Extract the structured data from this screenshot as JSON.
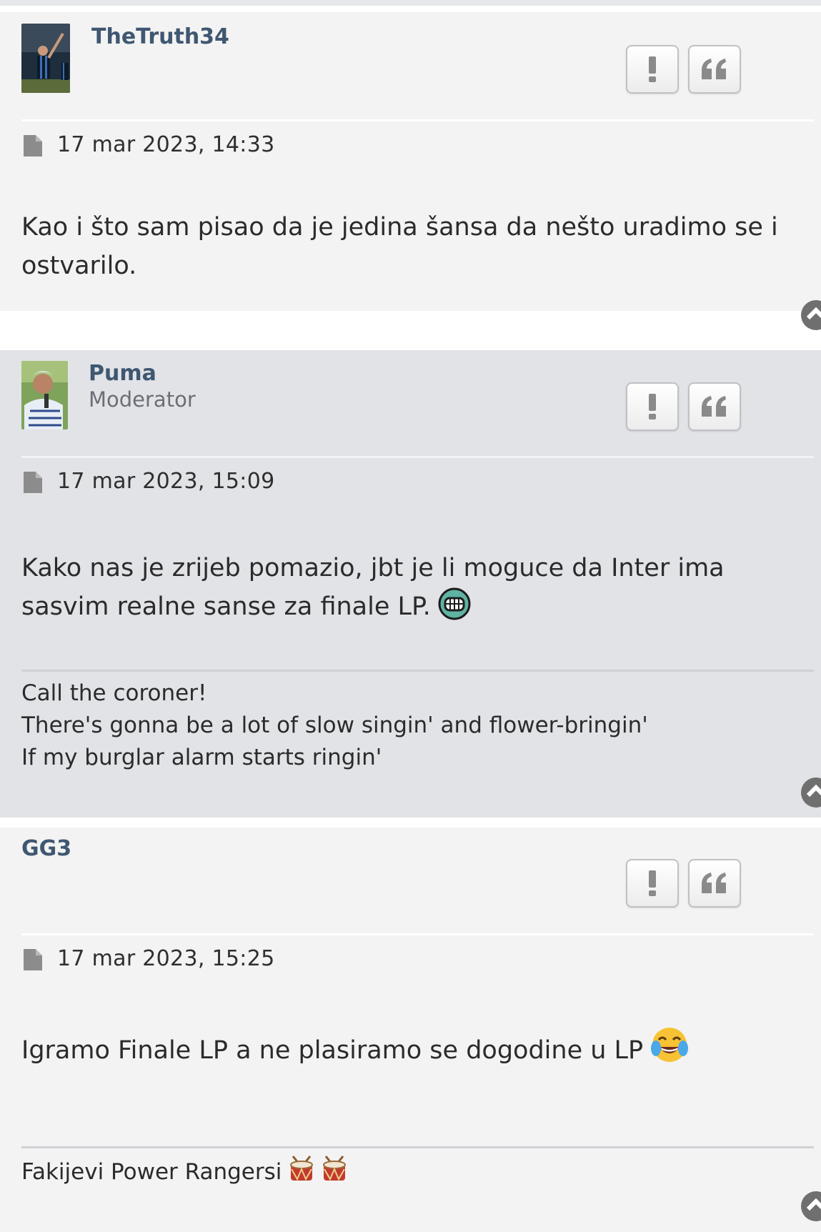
{
  "posts": [
    {
      "author": "TheTruth34",
      "rank": "",
      "date": "17 mar 2023, 14:33",
      "content": "Kao i što sam pisao da je jedina šansa da nešto uradimo se i ostvarilo.",
      "signature": []
    },
    {
      "author": "Puma",
      "rank": "Moderator",
      "date": "17 mar 2023, 15:09",
      "content": "Kako nas je zrijeb pomazio, jbt je li moguce da Inter ima sasvim realne sanse za finale LP.",
      "signature": [
        "Call the coroner!",
        "There's gonna be a lot of slow singin' and flower-bringin'",
        "If my burglar alarm starts ringin'"
      ]
    },
    {
      "author": "GG3",
      "rank": "",
      "date": "17 mar 2023, 15:25",
      "content": "Igramo Finale LP a ne plasiramo se dogodine u LP",
      "signature": [
        "Fakijevi Power Rangersi"
      ]
    }
  ],
  "icons": {
    "report": "exclamation-icon",
    "quote": "quote-icon",
    "date": "file-icon",
    "top": "chevron-up-circle-icon",
    "smiley_grin": "grin-smiley-icon",
    "emoji_laugh": "tears-of-joy-emoji-icon",
    "emoji_drum": "drum-emoji-icon"
  },
  "colors": {
    "username": "#3f5771",
    "post_bg_light": "#f3f3f3",
    "post_bg_dark": "#e2e3e7",
    "text": "#2b2b2b"
  }
}
